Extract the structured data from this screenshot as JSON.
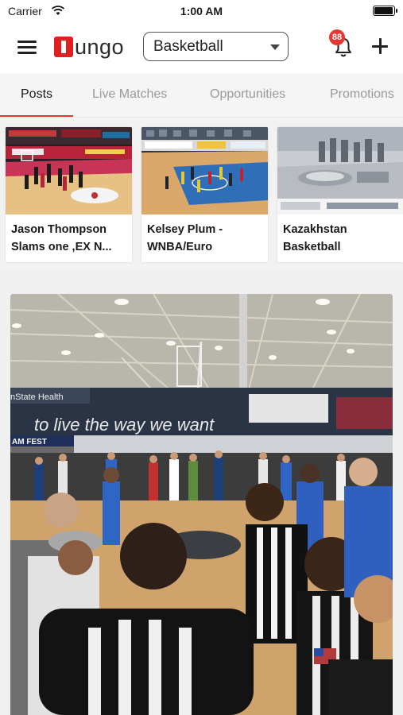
{
  "status_bar": {
    "carrier": "Carrier",
    "time": "1:00 AM",
    "battery_level": 1.0
  },
  "header": {
    "menu_icon": "hamburger-menu-icon",
    "logo_text": "ungo",
    "sport_selector": {
      "selected": "Basketball"
    },
    "notifications": {
      "icon": "bell-icon",
      "count": "88"
    },
    "add_icon": "plus-icon"
  },
  "tabs": {
    "items": [
      {
        "label": "Posts",
        "active": true
      },
      {
        "label": "Live Matches",
        "active": false
      },
      {
        "label": "Opportunities",
        "active": false
      },
      {
        "label": "Promotions",
        "active": false
      }
    ]
  },
  "featured": {
    "cards": [
      {
        "title": "Jason Thompson Slams one ,EX N...",
        "image": "basketball-game-arena-photo"
      },
      {
        "title": "Kelsey Plum -WNBA/Euro",
        "image": "basketball-court-overhead-photo"
      },
      {
        "title": "Kazakhstan Basketball",
        "image": "city-stadium-aerial-photo"
      }
    ]
  },
  "feed": {
    "post": {
      "image": "gym-referees-crowd-photo",
      "banner_text": "to live the way we want",
      "sign_left": "nState Health",
      "sign_fest": "AM FEST"
    }
  },
  "colors": {
    "accent": "#e53935",
    "logo_red": "#e02020",
    "tab_inactive": "#9a9a9a"
  }
}
